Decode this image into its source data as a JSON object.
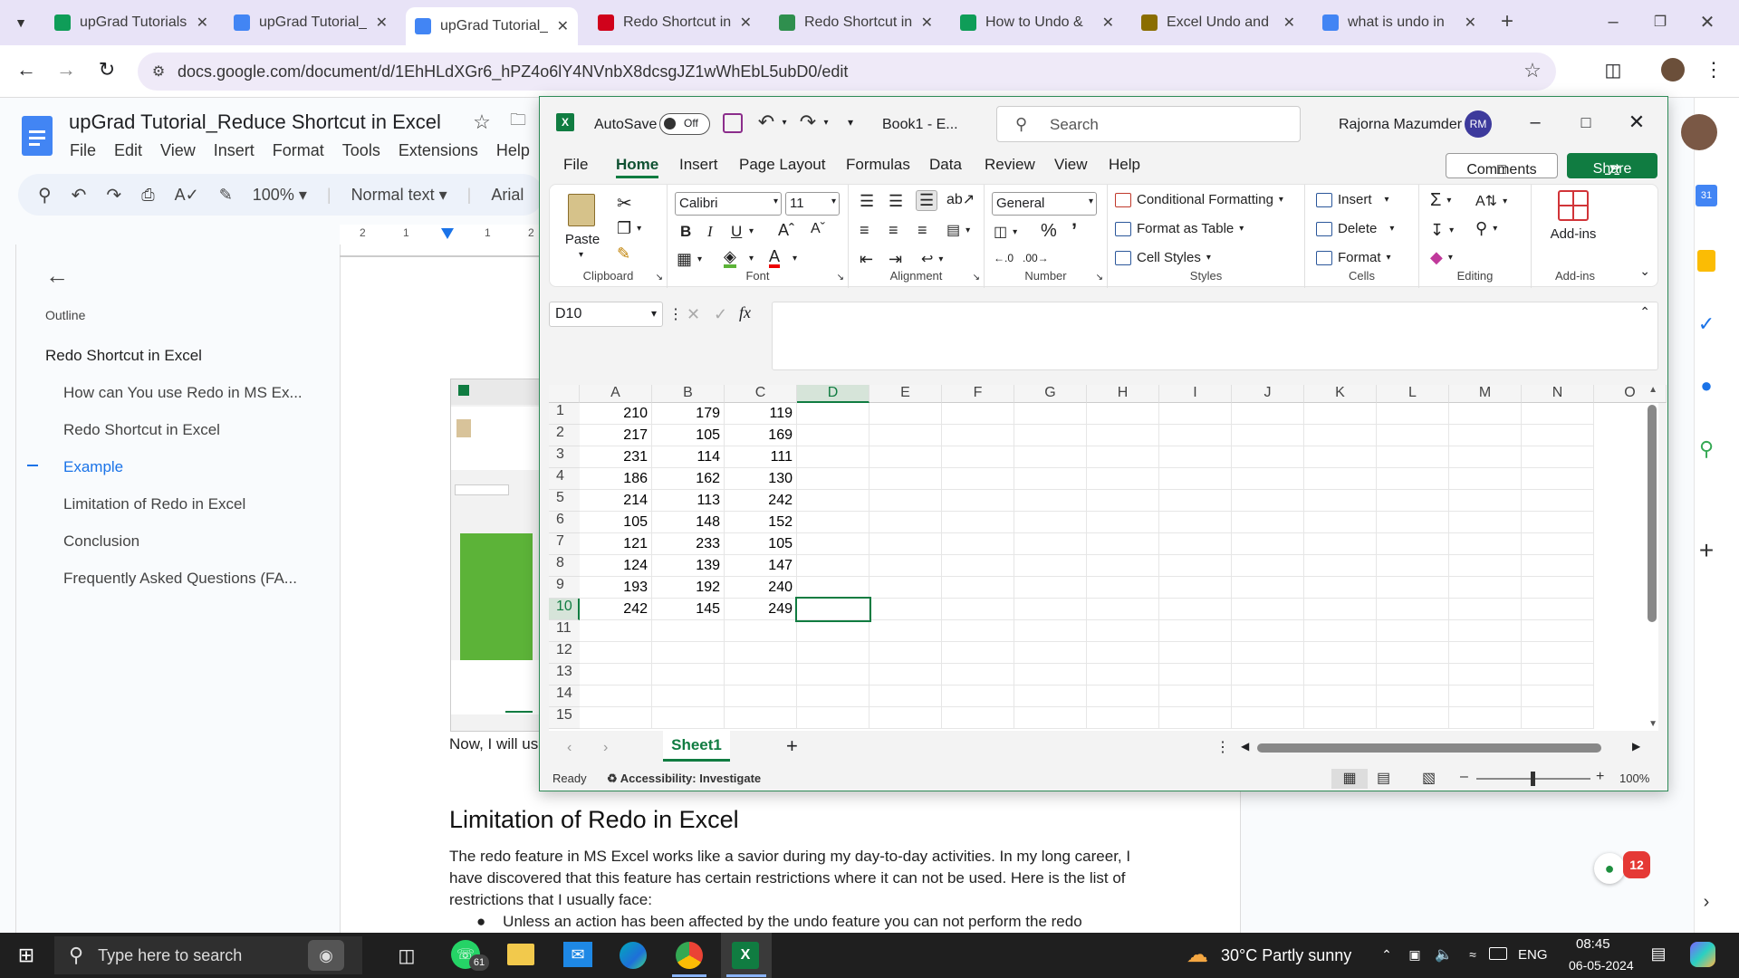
{
  "browser": {
    "tabs": [
      {
        "title": "upGrad Tutorials",
        "icon": "sheets-icon",
        "color": "#0f9d58"
      },
      {
        "title": "upGrad Tutorial_",
        "icon": "docs-icon",
        "color": "#4285f4"
      },
      {
        "title": "upGrad Tutorial_",
        "icon": "docs-icon",
        "color": "#4285f4"
      },
      {
        "title": "Redo Shortcut in",
        "icon": "v-icon",
        "color": "#d0021b"
      },
      {
        "title": "Redo Shortcut in",
        "icon": "move-icon",
        "color": "#2f8f4e"
      },
      {
        "title": "How to Undo &",
        "icon": "s-icon",
        "color": "#0f9d58"
      },
      {
        "title": "Excel Undo and",
        "icon": "badge-icon",
        "color": "#8a6d00"
      },
      {
        "title": "what is undo in",
        "icon": "google-icon",
        "color": "#4285f4"
      }
    ],
    "url": "docs.google.com/document/d/1EhHLdXGr6_hPZ4o6lY4NVnbX8dcsgJZ1wWhEbL5ubD0/edit"
  },
  "docs": {
    "title": "upGrad Tutorial_Reduce Shortcut in Excel",
    "menu": [
      "File",
      "Edit",
      "View",
      "Insert",
      "Format",
      "Tools",
      "Extensions",
      "Help"
    ],
    "toolbar": {
      "zoom": "100%",
      "style": "Normal text",
      "font": "Arial"
    },
    "ruler": [
      "2",
      "1",
      "1",
      "2"
    ],
    "outline_label": "Outline",
    "outline": [
      "Redo Shortcut in Excel",
      "How can You use Redo in MS Ex...",
      "Redo Shortcut in Excel",
      "Example",
      "Limitation of Redo in Excel",
      "Conclusion",
      "Frequently Asked Questions (FA..."
    ],
    "body_fragment": "Now, I will us",
    "heading": "Limitation of Redo in Excel",
    "paragraph": "The redo feature in MS Excel works like a savior during my day-to-day activities. In my long career, I have discovered that this feature has certain restrictions where it can not be used. Here is the list of restrictions that I usually face:",
    "bullet": "Unless an action has been affected by the undo feature you can not perform the redo"
  },
  "excel": {
    "autosave_label": "AutoSave",
    "autosave_state": "Off",
    "book": "Book1  -  E...",
    "search_placeholder": "Search",
    "user": "Rajorna Mazumder",
    "initials": "RM",
    "tabs": [
      "File",
      "Home",
      "Insert",
      "Page Layout",
      "Formulas",
      "Data",
      "Review",
      "View",
      "Help"
    ],
    "comments": "Comments",
    "share": "Share",
    "ribbon": {
      "paste": "Paste",
      "clipboard": "Clipboard",
      "font_name": "Calibri",
      "font_size": "11",
      "font": "Font",
      "alignment": "Alignment",
      "number_format": "General",
      "number": "Number",
      "conditional": "Conditional Formatting",
      "format_table": "Format as Table",
      "cell_styles": "Cell Styles",
      "styles": "Styles",
      "insert": "Insert",
      "delete": "Delete",
      "format": "Format",
      "cells": "Cells",
      "editing": "Editing",
      "addins": "Add-ins",
      "addins_group": "Add-ins"
    },
    "name_box": "D10",
    "columns": [
      "A",
      "B",
      "C",
      "D",
      "E",
      "F",
      "G",
      "H",
      "I",
      "J",
      "K",
      "L",
      "M",
      "N",
      "O"
    ],
    "rows": [
      "1",
      "2",
      "3",
      "4",
      "5",
      "6",
      "7",
      "8",
      "9",
      "10",
      "11",
      "12",
      "13",
      "14",
      "15"
    ],
    "data": [
      [
        "210",
        "179",
        "119"
      ],
      [
        "217",
        "105",
        "169"
      ],
      [
        "231",
        "114",
        "111"
      ],
      [
        "186",
        "162",
        "130"
      ],
      [
        "214",
        "113",
        "242"
      ],
      [
        "105",
        "148",
        "152"
      ],
      [
        "121",
        "233",
        "105"
      ],
      [
        "124",
        "139",
        "147"
      ],
      [
        "193",
        "192",
        "240"
      ],
      [
        "242",
        "145",
        "249"
      ]
    ],
    "sheet": "Sheet1",
    "status": "Ready",
    "accessibility": "Accessibility: Investigate",
    "zoom": "100%"
  },
  "taskbar": {
    "search_placeholder": "Type here to search",
    "whatsapp_badge": "61",
    "weather": "30°C  Partly sunny",
    "lang": "ENG",
    "time": "08:45",
    "date": "06-05-2024"
  }
}
